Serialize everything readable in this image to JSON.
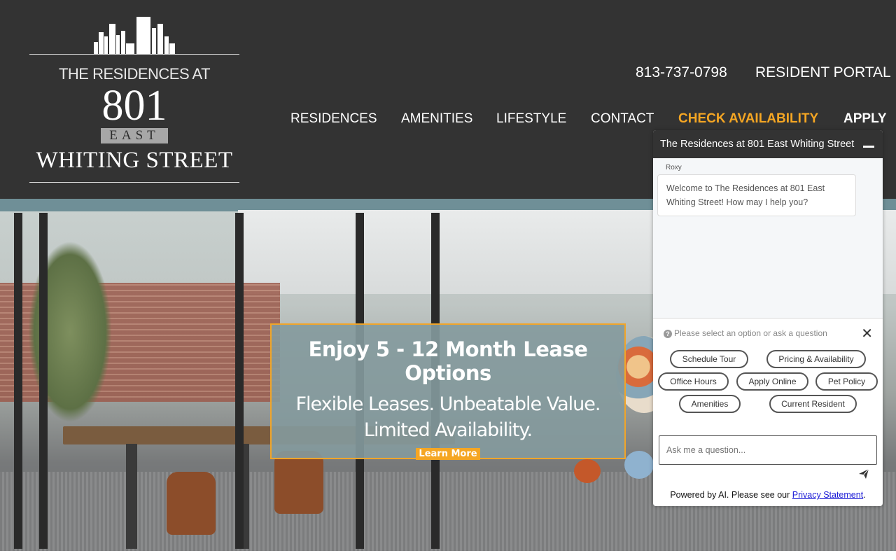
{
  "logo": {
    "pre_title": "THE RESIDENCES AT",
    "number": "801",
    "east": "EAST",
    "street": "WHITING STREET"
  },
  "utility": {
    "phone": "813-737-0798",
    "resident_portal": "RESIDENT PORTAL"
  },
  "nav": {
    "residences": "RESIDENCES",
    "amenities": "AMENITIES",
    "lifestyle": "LIFESTYLE",
    "contact": "CONTACT",
    "check_availability": "CHECK AVAILABILITY",
    "apply": "APPLY"
  },
  "colors": {
    "header_bg": "#333333",
    "accent": "#f5a623",
    "link": "#1a1ad6"
  },
  "promo": {
    "heading": "Enjoy 5 - 12 Month Lease Options",
    "line1": "Flexible Leases. Unbeatable Value.",
    "line2": "Limited Availability.",
    "button": "Learn More"
  },
  "chat": {
    "title": "The Residences at 801 East Whiting Street",
    "agent_name": "Roxy",
    "welcome": "Welcome to The Residences at 801 East Whiting Street! How may I help you?",
    "hint": "Please select an option or ask a question",
    "options": {
      "schedule_tour": "Schedule Tour",
      "pricing": "Pricing & Availability",
      "office_hours": "Office Hours",
      "apply_online": "Apply Online",
      "pet_policy": "Pet Policy",
      "amenities": "Amenities",
      "current_resident": "Current Resident"
    },
    "input_placeholder": "Ask me a question...",
    "powered_prefix": "Powered by AI. Please see our ",
    "privacy_link": "Privacy Statement",
    "powered_suffix": "."
  },
  "icons": {
    "minimize": "minimize-icon",
    "close": "close-icon",
    "send": "send-icon",
    "help": "help-icon"
  }
}
